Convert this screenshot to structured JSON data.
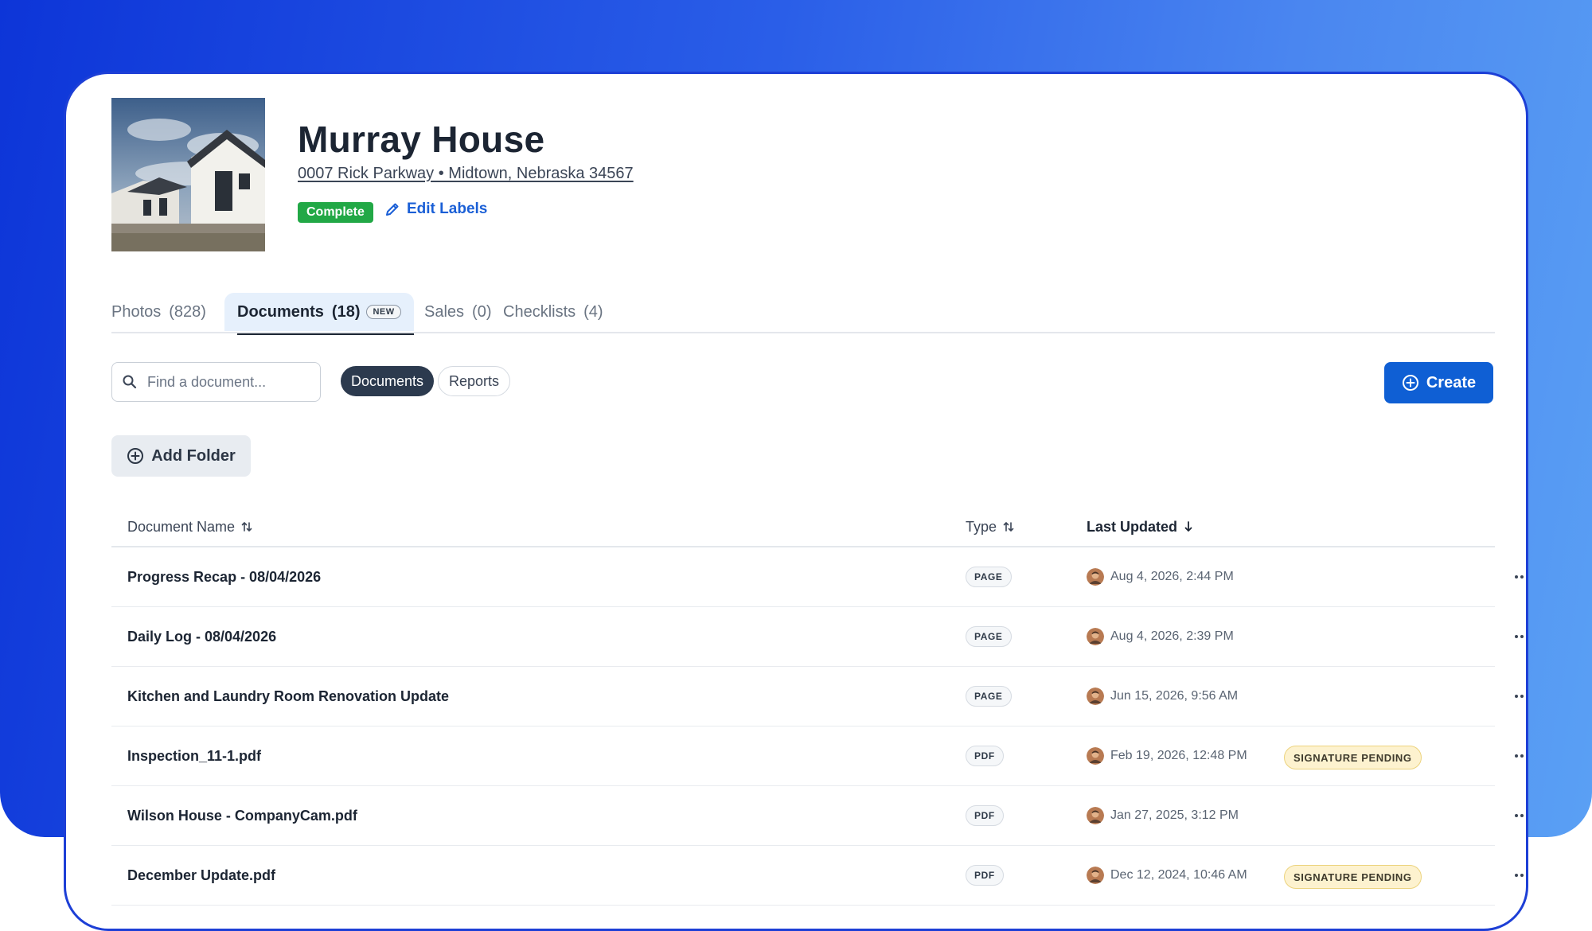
{
  "project": {
    "title": "Murray House",
    "address": "0007 Rick Parkway • Midtown, Nebraska 34567",
    "status": "Complete",
    "edit_labels": "Edit Labels"
  },
  "tabs": [
    {
      "label": "Photos",
      "count": "(828)"
    },
    {
      "label": "Documents",
      "count": "(18)",
      "badge": "NEW",
      "active": true
    },
    {
      "label": "Sales",
      "count": "(0)"
    },
    {
      "label": "Checklists",
      "count": "(4)"
    }
  ],
  "toolbar": {
    "search_placeholder": "Find a document...",
    "filters": [
      "Documents",
      "Reports"
    ],
    "active_filter": "Documents",
    "create_label": "Create",
    "add_folder_label": "Add Folder"
  },
  "table": {
    "columns": {
      "name": "Document Name",
      "type": "Type",
      "updated": "Last Updated"
    },
    "rows": [
      {
        "name": "Progress Recap - 08/04/2026",
        "type": "PAGE",
        "updated": "Aug 4, 2026, 2:44 PM",
        "status": ""
      },
      {
        "name": "Daily Log - 08/04/2026",
        "type": "PAGE",
        "updated": "Aug 4, 2026, 2:39 PM",
        "status": ""
      },
      {
        "name": "Kitchen and Laundry Room Renovation Update",
        "type": "PAGE",
        "updated": "Jun 15, 2026, 9:56 AM",
        "status": ""
      },
      {
        "name": "Inspection_11-1.pdf",
        "type": "PDF",
        "updated": "Feb 19, 2026, 12:48 PM",
        "status": "SIGNATURE PENDING"
      },
      {
        "name": "Wilson House - CompanyCam.pdf",
        "type": "PDF",
        "updated": "Jan 27, 2025, 3:12 PM",
        "status": ""
      },
      {
        "name": "December Update.pdf",
        "type": "PDF",
        "updated": "Dec 12, 2024, 10:46 AM",
        "status": "SIGNATURE PENDING"
      }
    ]
  },
  "colors": {
    "brand_blue": "#0f5fd4",
    "link_blue": "#1a5fd6",
    "complete_green": "#22a846",
    "signature_pending_bg": "#fdf2cf",
    "active_filter_bg": "#2c3a4e"
  },
  "icons": {
    "search": "search-icon",
    "edit": "pencil-icon",
    "add": "plus-circle-icon",
    "sort": "sort-icon",
    "sort_desc": "arrow-down-icon",
    "more": "more-icon",
    "avatar": "user-avatar"
  }
}
